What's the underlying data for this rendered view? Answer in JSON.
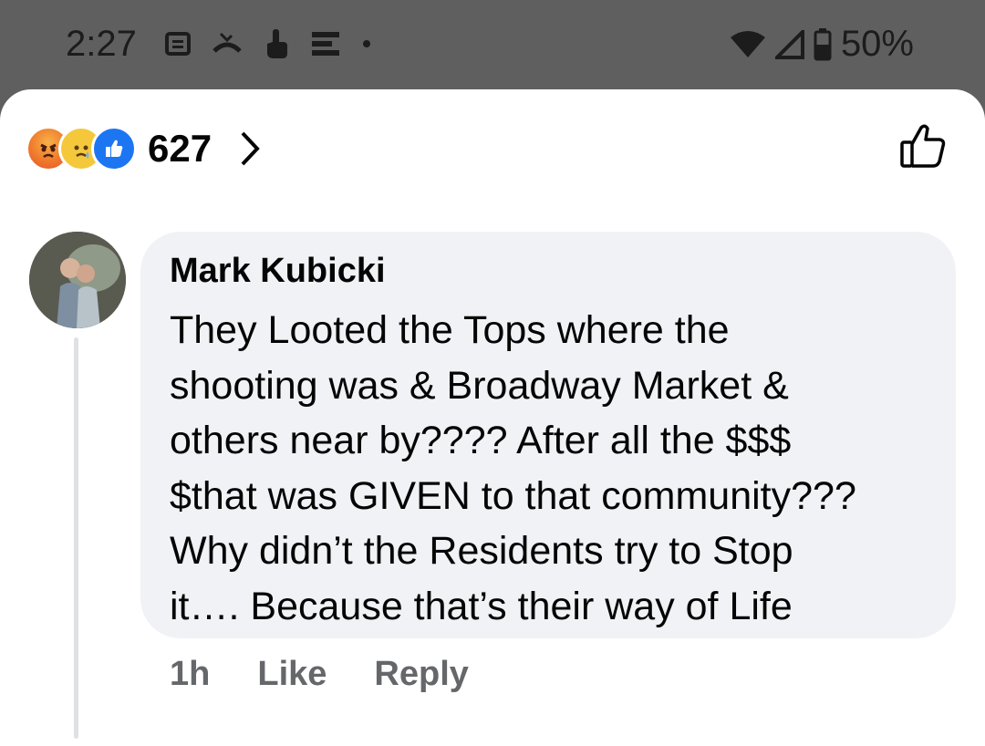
{
  "status_bar": {
    "time": "2:27",
    "battery": "50%",
    "icons": [
      "notification-icon",
      "missed-call-icon",
      "touch-icon",
      "list-icon",
      "dot-icon",
      "wifi-icon",
      "signal-icon",
      "battery-icon"
    ]
  },
  "reactions": {
    "types": [
      "angry",
      "sad",
      "like"
    ],
    "count": "627"
  },
  "comment": {
    "author": "Mark Kubicki",
    "text": "They Looted the Tops where the\nshooting was & Broadway Market &\nothers near by???? After all the $$$\n$that was GIVEN to that community???\nWhy didn’t the Residents try to Stop\nit…. Because that’s their way of Life",
    "time": "1h",
    "like_label": "Like",
    "reply_label": "Reply"
  },
  "colors": {
    "bubble": "#f0f2f5",
    "secondary_text": "#65676b",
    "like_blue": "#1c76f2"
  }
}
